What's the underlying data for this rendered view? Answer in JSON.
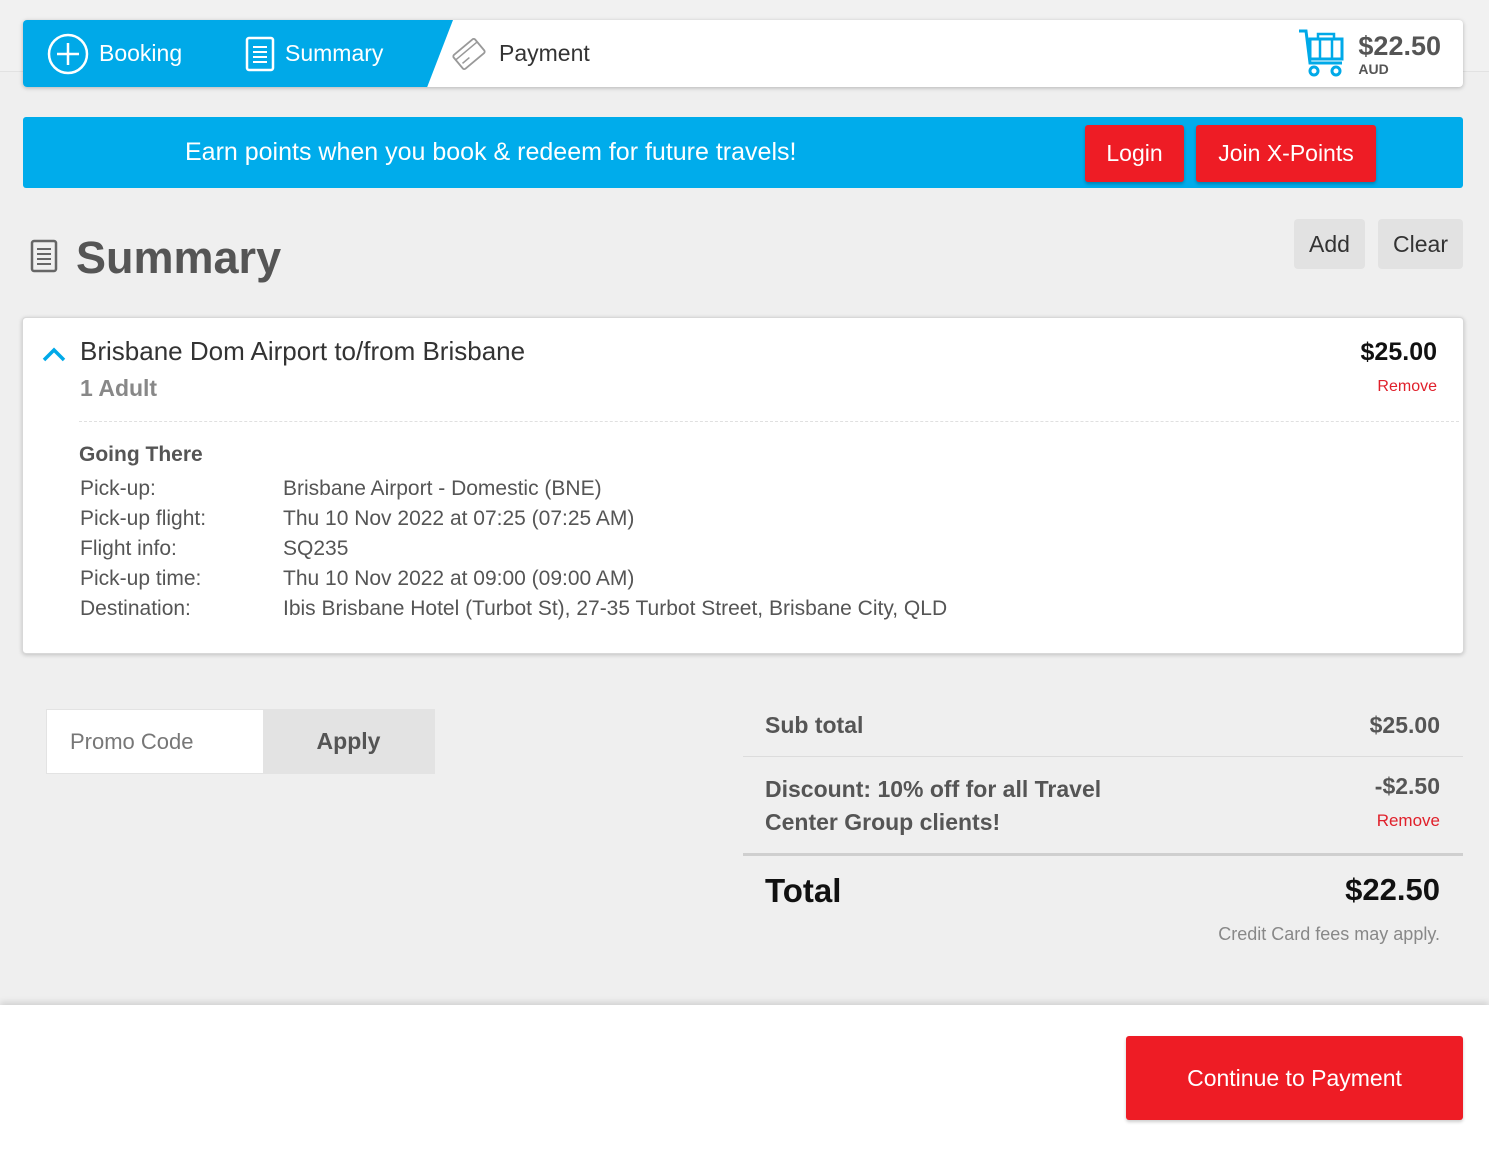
{
  "steps": {
    "booking": "Booking",
    "summary": "Summary",
    "payment": "Payment"
  },
  "cart": {
    "price": "$22.50",
    "currency": "AUD"
  },
  "banner": {
    "message": "Earn points when you book & redeem for future travels!",
    "login_label": "Login",
    "join_label": "Join X-Points"
  },
  "summary": {
    "title": "Summary",
    "add_label": "Add",
    "clear_label": "Clear"
  },
  "trip": {
    "route": "Brisbane Dom Airport to/from Brisbane",
    "passengers": "1 Adult",
    "price": "$25.00",
    "remove_label": "Remove",
    "section_title": "Going There",
    "details": [
      {
        "label": "Pick-up:",
        "value": "Brisbane Airport - Domestic (BNE)"
      },
      {
        "label": "Pick-up flight:",
        "value": "Thu 10 Nov 2022 at 07:25 (07:25 AM)"
      },
      {
        "label": "Flight info:",
        "value": "SQ235"
      },
      {
        "label": "Pick-up time:",
        "value": "Thu 10 Nov 2022 at 09:00 (09:00 AM)"
      },
      {
        "label": "Destination:",
        "value": "Ibis Brisbane Hotel (Turbot St), 27-35 Turbot Street, Brisbane City, QLD"
      }
    ]
  },
  "promo": {
    "placeholder": "Promo Code",
    "apply_label": "Apply"
  },
  "totals": {
    "subtotal_label": "Sub total",
    "subtotal_value": "$25.00",
    "discount_label": "Discount: 10% off for all Travel Center Group clients!",
    "discount_value": "-$2.50",
    "discount_remove": "Remove",
    "total_label": "Total",
    "total_value": "$22.50",
    "fees_note": "Credit Card fees may apply."
  },
  "footer": {
    "continue_label": "Continue to Payment"
  },
  "colors": {
    "brand_blue": "#00aceb",
    "accent_red": "#ee1c25"
  },
  "icons": {
    "booking": "plus-circle-icon",
    "summary": "document-icon",
    "payment": "credit-card-icon",
    "cart": "cart-icon",
    "collapse": "chevron-up-icon"
  }
}
